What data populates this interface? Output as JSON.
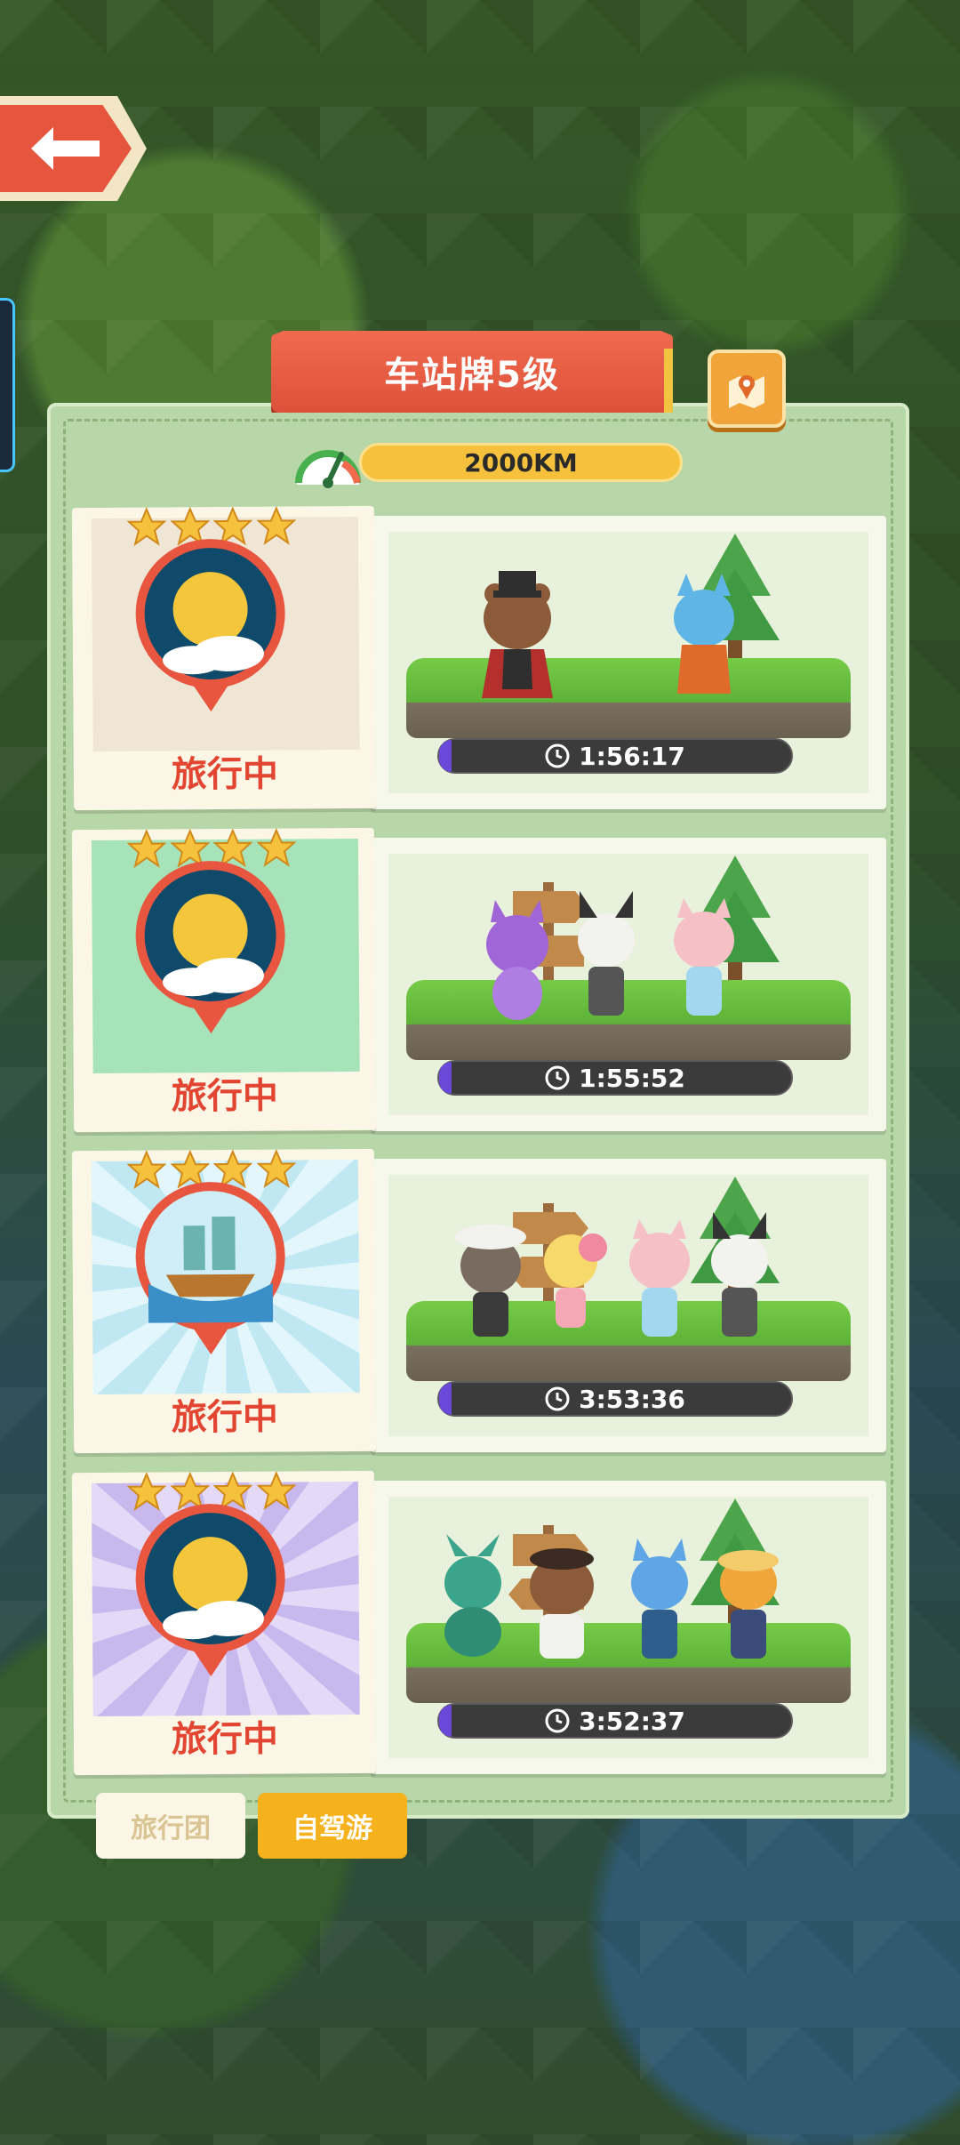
{
  "header": {
    "title": "车站牌5级",
    "distance": "2000KM"
  },
  "cards": [
    {
      "status": "旅行中",
      "timer": "1:56:17",
      "stars": 4,
      "badge": "moon",
      "bg": "#f0e6d6"
    },
    {
      "status": "旅行中",
      "timer": "1:55:52",
      "stars": 4,
      "badge": "moon",
      "bg": "#a6e3b8"
    },
    {
      "status": "旅行中",
      "timer": "3:53:36",
      "stars": 4,
      "badge": "ship",
      "bg": "#d9f2f7"
    },
    {
      "status": "旅行中",
      "timer": "3:52:37",
      "stars": 4,
      "badge": "moon",
      "bg": "#d5c7f1"
    }
  ],
  "tabs": {
    "group_tour": "旅行团",
    "self_drive": "自驾游"
  },
  "colors": {
    "accent_red": "#e6553d",
    "status_red": "#e24632",
    "gold": "#f6c23d",
    "panel_green": "#b8d7a8"
  },
  "icons": [
    "back-arrow-icon",
    "map-pin-icon",
    "speed-gauge-icon",
    "clock-icon",
    "star-icon",
    "moon-badge-icon",
    "ship-badge-icon"
  ]
}
